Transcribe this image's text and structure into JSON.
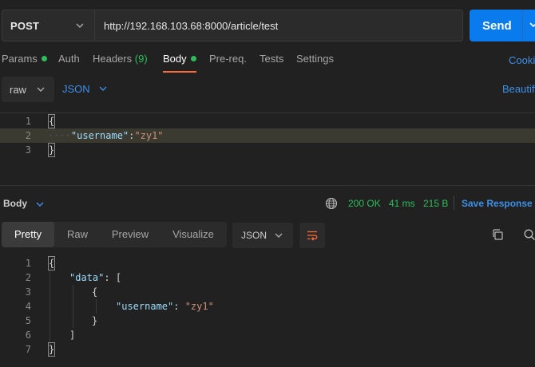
{
  "request": {
    "method": "POST",
    "url": "http://192.168.103.68:8000/article/test",
    "send_label": "Send"
  },
  "request_tabs": {
    "params": "Params",
    "auth": "Auth",
    "headers": "Headers",
    "headers_count": "(9)",
    "body": "Body",
    "prereq": "Pre-req.",
    "tests": "Tests",
    "settings": "Settings",
    "cookies": "Cookies"
  },
  "body_options": {
    "mode": "raw",
    "language": "JSON",
    "beautify": "Beautify"
  },
  "request_body": {
    "line_numbers": [
      "1",
      "2",
      "3"
    ],
    "open_brace": "{",
    "key": "\"username\"",
    "colon": ":",
    "value": "\"zy1\"",
    "close_brace": "}"
  },
  "response_bar": {
    "label": "Body",
    "status": "200 OK",
    "time": "41 ms",
    "size": "215 B",
    "save": "Save Response"
  },
  "response_view": {
    "tabs": [
      "Pretty",
      "Raw",
      "Preview",
      "Visualize"
    ],
    "active_tab": "Pretty",
    "format": "JSON"
  },
  "response_body": {
    "line_numbers": [
      "1",
      "2",
      "3",
      "4",
      "5",
      "6",
      "7"
    ],
    "open_brace": "{",
    "data_key": "\"data\"",
    "colon_space": ": ",
    "open_bracket": "[",
    "inner_open": "{",
    "username_key": "\"username\"",
    "username_value": "\"zy1\"",
    "inner_close": "}",
    "close_bracket": "]",
    "close_brace": "}"
  },
  "colors": {
    "accent_blue": "#097bed",
    "link_blue": "#3d8fe8",
    "status_green": "#2ebd5a",
    "tab_underline": "#ff6c37",
    "background": "#212121"
  },
  "icons": {
    "method_dropdown": "chevron-down-icon",
    "send_dropdown": "chevron-down-icon",
    "globe": "globe-icon",
    "wrap": "wrap-lines-icon",
    "copy": "copy-icon",
    "search": "search-icon"
  }
}
